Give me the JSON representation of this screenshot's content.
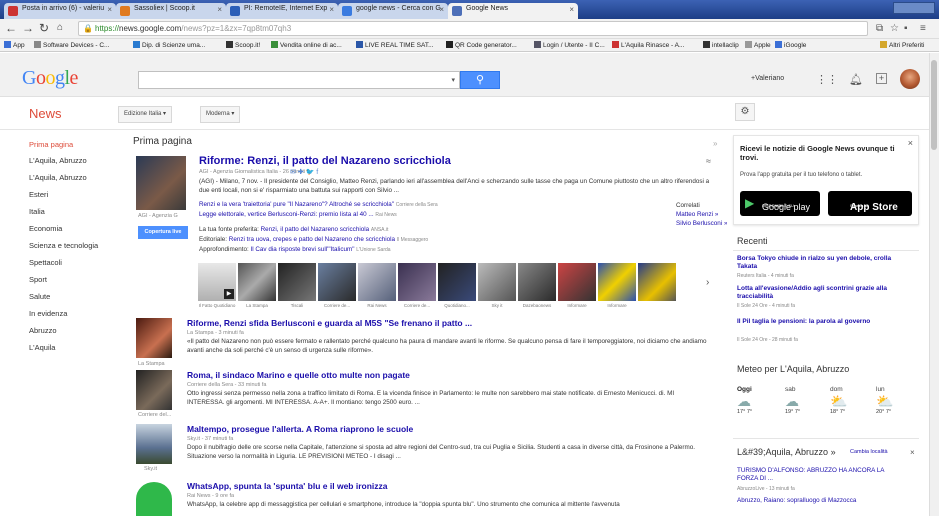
{
  "browser": {
    "tabs": [
      {
        "label": "Posta in arrivo (6) - valeriu"
      },
      {
        "label": "Sassoliex | Scoop.it"
      },
      {
        "label": "PI: RemoteIE, Internet Exp"
      },
      {
        "label": "google news - Cerca con G"
      },
      {
        "label": "Google News"
      }
    ],
    "url_scheme": "https://",
    "url_host": "news.google.com",
    "url_rest": "/news?pz=1&zx=7qp8tm07qh3",
    "bookmarks": [
      "App",
      "Software Devices - C...",
      "Dip. di Scienze uma...",
      "Scoop.it!",
      "Vendita online di ac...",
      "LIVE REAL TIME SAT...",
      "QR Code generator...",
      "Login / Utente - II C...",
      "L'Aquila Rinasce - A...",
      "intellaclip",
      "Apple",
      "iGoogle",
      "Altri Preferiti"
    ]
  },
  "google": {
    "logo": "Google",
    "user": "+Valeriano"
  },
  "news": {
    "label": "News",
    "edition": "Edizione Italia",
    "view": "Moderna"
  },
  "sidebar": {
    "items": [
      "Prima pagina",
      "L'Aquila, Abruzzo",
      "L'Aquila, Abruzzo",
      "Esteri",
      "Italia",
      "Economia",
      "Scienza e tecnologia",
      "Spettacoli",
      "Sport",
      "Salute",
      "In evidenza",
      "Abruzzo",
      "L'Aquila"
    ]
  },
  "main": {
    "header": "Prima pagina",
    "top_story": {
      "title": "Riforme: Renzi, il patto del Nazareno scricchiola",
      "source": "AGI - Agenzia Giornalistica Italia - 26 minuti fa",
      "snippet": "(AGI) - Milano, 7 nov. - Il presidente del Consiglio, Matteo Renzi, parlando ieri all'assemblea dell'Anci e scherzando sulle tasse che paga un Comune piuttosto che un altro riferendosi a due enti locali, non si e' risparmiato una battuta sui rapporti con Silvio ...",
      "thumb_caption": "AGI - Agenzia G",
      "related_1": "Renzi e la vera 'traiettoria' pure \"Il Nazareno\"? Altroché se scricchiola\"",
      "related_1_src": "Corriere della Sera",
      "related_2": "Legge elettorale, vertice Berlusconi-Renzi: premio lista al 40 ...",
      "related_2_src": "Rai News",
      "fonte_label": "La tua fonte preferita:",
      "fonte_link": "Renzi, il patto del Nazareno scricchiola",
      "fonte_src": "ANSA.it",
      "editoriale_label": "Editoriale:",
      "editoriale_link": "Renzi tra uova, crepes e patto del Nazareno che scricchiola",
      "editoriale_src": "Il Messaggero",
      "approf_label": "Approfondimento:",
      "approf_link": "Il Cav dia risposte brevi sull'\"Italicum\"",
      "approf_src": "L'Unione Sarda",
      "correlati_label": "Correlati",
      "correlati_1": "Matteo Renzi »",
      "correlati_2": "Silvio Berlusconi »",
      "coverage_button": "Copertura live",
      "strip_captions": [
        "Il Fatto Quotidiano",
        "La Stampa",
        "Tiscali",
        "Corriere de...",
        "Rai News",
        "Corriere de...",
        "Quotidiano...",
        "Sky it",
        "Dazebaonews",
        "Informare",
        "Informare"
      ]
    },
    "stories": [
      {
        "title": "Riforme, Renzi sfida Berlusconi e guarda al M5S \"Se frenano il patto ...",
        "source": "La Stampa - 3 minuti fa",
        "snippet": "«Il patto del Nazareno non può essere fermato e rallentato perché qualcuno ha paura di mandare avanti le riforme. Se qualcuno pensa di fare il temporeggiatore, noi diciamo che andiamo avanti anche da soli perché c'è un senso di urgenza sulle riforme».",
        "thumb_caption": "La Stampa"
      },
      {
        "title": "Roma, il sindaco Marino e quelle otto multe non pagate",
        "source": "Corriere della Sera - 33 minuti fa",
        "snippet": "Otto ingressi senza permesso nella zona a traffico limitato di Roma. E la vicenda finisce in Parlamento: le multe non sarebbero mai state notificate. di Ernesto Menicucci. di. MI INTERESSA. gli argomenti. MI INTERESSA. A-A+. Il montiano: tengo 2500 euro. ...",
        "thumb_caption": "Corriere del..."
      },
      {
        "title": "Maltempo, prosegue l'allerta. A Roma riaprono le scuole",
        "source": "Sky.it - 37 minuti fa",
        "snippet": "Dopo il nubifragio delle ore scorse nella Capitale, l'attenzione si sposta ad altre regioni del Centro-sud, tra cui Puglia e Sicilia. Studenti a casa in diverse città, da Frosinone a Palermo. Situazione verso la normalità in Liguria. LE PREVISIONI METEO - I disagi ...",
        "thumb_caption": "Sky.it"
      },
      {
        "title": "WhatsApp, spunta la 'spunta' blu e il web ironizza",
        "source": "Rai News - 9 ore fa",
        "snippet": "WhatsApp, la celebre app di messaggistica per cellulari e smartphone, introduce la \"doppia spunta blu\". Uno strumento che comunica al mittente l'avvenuta",
        "thumb_caption": ""
      }
    ]
  },
  "right": {
    "promo_title": "Ricevi le notizie di Google News ovunque ti trovi.",
    "promo_sub": "Prova l'app gratuita per il tuo telefono o tablet.",
    "google_play_small": "DISPONIBILE SU",
    "google_play": "Google play",
    "app_store_small": "Scarica su",
    "app_store": "App Store",
    "recenti_label": "Recenti",
    "recenti": [
      {
        "title": "Borsa Tokyo chiude in rialzo su yen debole, crolla Takata",
        "src": "Reuters Italia - 4 minuti fa"
      },
      {
        "title": "Lotta all'evasione/Addio agli scontrini grazie alla tracciabilità",
        "src": "Il Sole 24 Ore - 4 minuti fa"
      },
      {
        "title": "Il Pil taglia le pensioni: la parola al governo",
        "src": "Il Sole 24 Ore - 28 minuti fa"
      }
    ],
    "meteo_label": "Meteo per L'Aquila, Abruzzo",
    "weather": [
      {
        "day": "Oggi",
        "temp": "17° 7°",
        "icon": "cloud-icon"
      },
      {
        "day": "sab",
        "temp": "19° 7°",
        "icon": "cloud-icon"
      },
      {
        "day": "dom",
        "temp": "18° 7°",
        "icon": "sun-cloud-icon"
      },
      {
        "day": "lun",
        "temp": "20° 7°",
        "icon": "sun-cloud-icon"
      }
    ],
    "local_label": "L&#39;Aquila, Abruzzo »",
    "cambia": "Cambia località",
    "local_1": "TURISMO D'ALFONSO: ABRUZZO HA ANCORA LA FORZA DI ...",
    "local_1_src": "AbruzzoLive - 13 minuti fa",
    "local_2": "Abruzzo, Raiano: sopralluogo di Mazzocca"
  },
  "colors": {
    "accent": "#dd4b39",
    "link": "#1a0dab",
    "button": "#4d90fe"
  }
}
